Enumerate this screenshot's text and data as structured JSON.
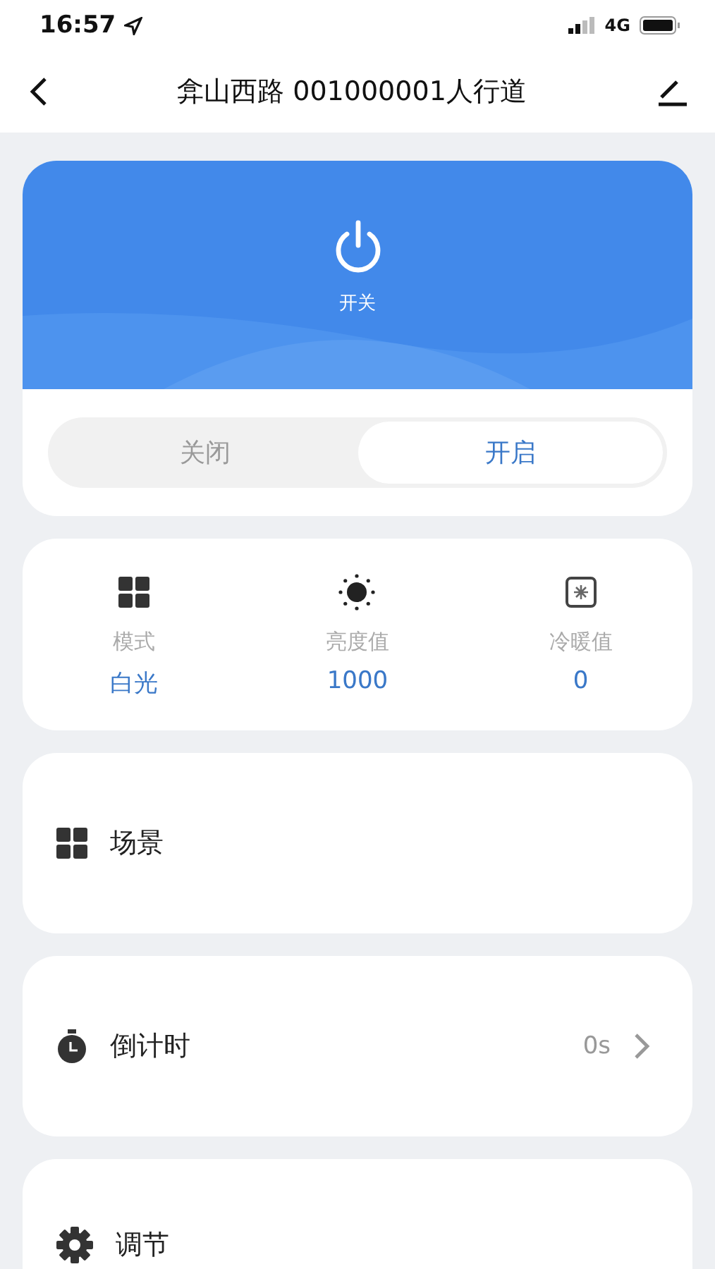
{
  "status_bar": {
    "time": "16:57",
    "network": "4G"
  },
  "nav": {
    "title": "弇山西路 001000001人行道"
  },
  "power": {
    "label": "开关",
    "options": [
      {
        "label": "关闭",
        "selected": false
      },
      {
        "label": "开启",
        "selected": true
      }
    ]
  },
  "stats": [
    {
      "kind": "mode",
      "label": "模式",
      "value": "白光"
    },
    {
      "kind": "brightness",
      "label": "亮度值",
      "value": "1000"
    },
    {
      "kind": "temperature",
      "label": "冷暖值",
      "value": "0"
    }
  ],
  "features": [
    {
      "kind": "scene",
      "label": "场景"
    },
    {
      "kind": "countdown",
      "label": "倒计时",
      "value": "0s"
    },
    {
      "kind": "adjust",
      "label": "调节"
    }
  ]
}
